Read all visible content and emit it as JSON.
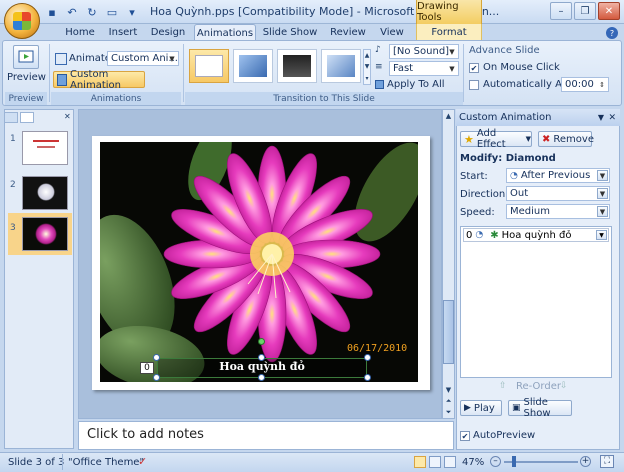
{
  "window": {
    "title": "Hoa Quỳnh.pps [Compatibility Mode] - Microsoft PowerPoint n...",
    "context_tab": "Drawing Tools"
  },
  "qat": {
    "icons": [
      "save-icon",
      "undo-icon",
      "redo-icon",
      "open-icon",
      "qat-customize-icon"
    ]
  },
  "tabs": [
    {
      "label": "Home"
    },
    {
      "label": "Insert"
    },
    {
      "label": "Design"
    },
    {
      "label": "Animations"
    },
    {
      "label": "Slide Show"
    },
    {
      "label": "Review"
    },
    {
      "label": "View"
    },
    {
      "label": "Format"
    }
  ],
  "ribbon": {
    "preview": {
      "button": "Preview",
      "group": "Preview"
    },
    "animations": {
      "animate_label": "Animate:",
      "animate_value": "Custom Ani...",
      "custom_button": "Custom Animation",
      "group": "Animations"
    },
    "transition": {
      "sound_value": "[No Sound]",
      "speed_value": "Fast",
      "apply_all": "Apply To All",
      "group": "Transition to This Slide"
    },
    "advance": {
      "title": "Advance Slide",
      "on_mouse_click": "On Mouse Click",
      "auto_after": "Automatically After:",
      "auto_time": "00:00"
    }
  },
  "slides": [
    {
      "num": "1"
    },
    {
      "num": "2"
    },
    {
      "num": "3"
    }
  ],
  "slide": {
    "date_stamp": "06/17/2010",
    "caption": "Hoa quỳnh đỏ",
    "anim_tag": "0"
  },
  "notes": {
    "placeholder": "Click to add notes"
  },
  "custom_animation": {
    "title": "Custom Animation",
    "add_effect": "Add Effect",
    "remove": "Remove",
    "modify": "Modify: Diamond",
    "start_label": "Start:",
    "start_value": "After Previous",
    "direction_label": "Direction:",
    "direction_value": "Out",
    "speed_label": "Speed:",
    "speed_value": "Medium",
    "list_item": {
      "order": "0",
      "name": "Hoa quỳnh đỏ"
    },
    "reorder": "Re-Order",
    "play": "Play",
    "slide_show": "Slide Show",
    "autopreview": "AutoPreview"
  },
  "status": {
    "slide": "Slide 3 of 3",
    "theme": "\"Office Theme\"",
    "zoom": "47%"
  }
}
